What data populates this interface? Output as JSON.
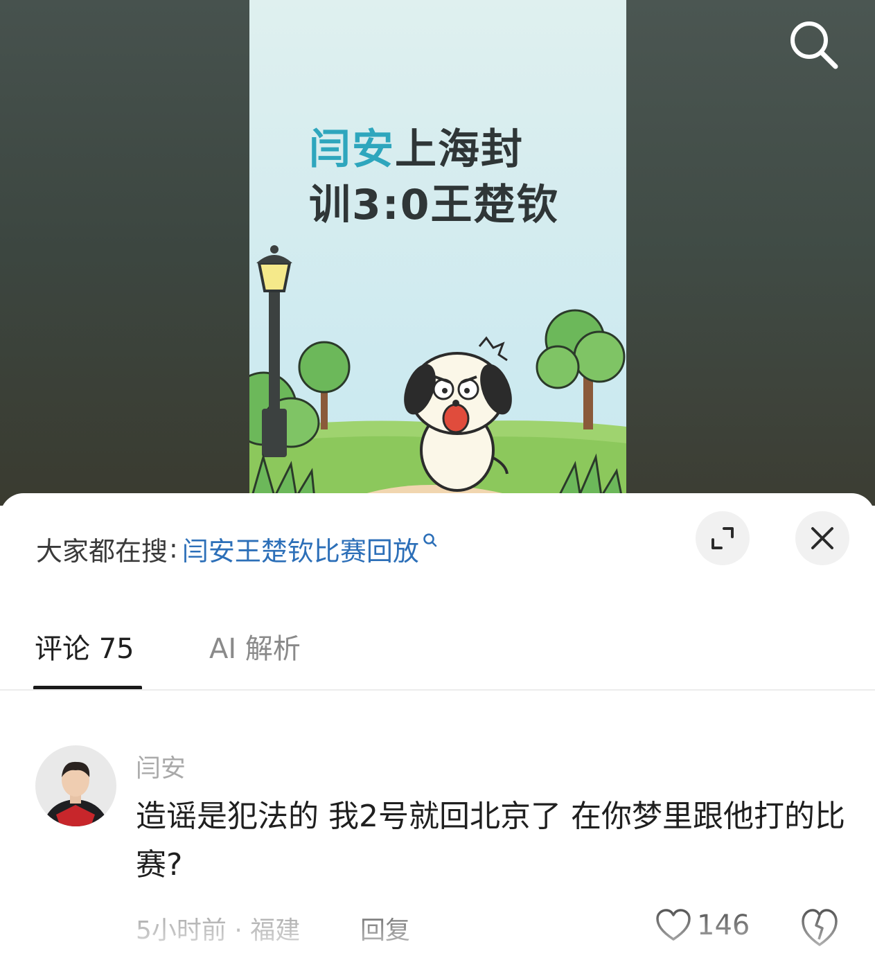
{
  "video": {
    "poster_title_highlight": "闫安",
    "poster_title_line1_rest": "上海封",
    "poster_title_line2": "训3:0王楚钦",
    "icons": {
      "search": "search-icon"
    }
  },
  "panel": {
    "search_suggest": {
      "prefix": "大家都在搜",
      "colon": ":",
      "query": "闫安王楚钦比赛回放"
    },
    "buttons": {
      "expand": "expand-icon",
      "close": "close-icon"
    },
    "tabs": [
      {
        "label": "评论 75",
        "active": true
      },
      {
        "label": "AI 解析",
        "active": false
      }
    ]
  },
  "comment": {
    "author": "闫安",
    "text": "造谣是犯法的 我2号就回北京了 在你梦里跟他打的比赛?",
    "time_location": "5小时前 · 福建",
    "reply_label": "回复",
    "likes": "146"
  },
  "colors": {
    "link": "#2c6fb8",
    "highlight": "#2ea6bd",
    "text": "#1f1f1f",
    "muted": "#a9a9a9"
  }
}
